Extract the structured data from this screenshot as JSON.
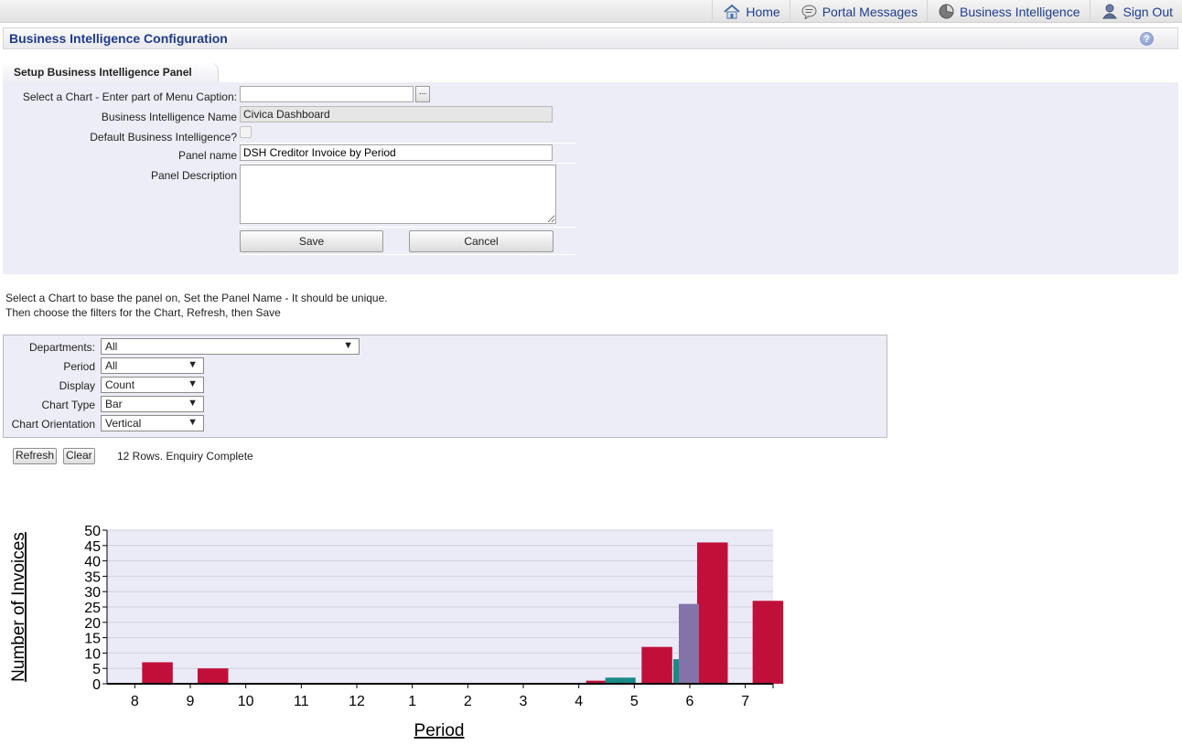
{
  "nav": {
    "home": "Home",
    "portal_messages": "Portal Messages",
    "business_intelligence": "Business Intelligence",
    "sign_out": "Sign Out"
  },
  "title": "Business Intelligence Configuration",
  "tab_label": "Setup Business Intelligence Panel",
  "form": {
    "select_chart_label": "Select a Chart - Enter part of Menu Caption:",
    "select_chart_value": "",
    "ellipsis_label": "...",
    "bi_name_label": "Business Intelligence Name",
    "bi_name_value": "Civica Dashboard",
    "default_bi_label": "Default Business Intelligence?",
    "default_bi_checked": false,
    "panel_name_label": "Panel name",
    "panel_name_value": "DSH Creditor Invoice by Period",
    "panel_description_label": "Panel Description",
    "panel_description_value": "",
    "save_label": "Save",
    "cancel_label": "Cancel"
  },
  "instructions": {
    "line1": "Select a Chart to base the panel on, Set the Panel Name - It should be unique.",
    "line2": "Then choose the filters for the Chart, Refresh, then Save"
  },
  "filters": {
    "departments_label": "Departments:",
    "departments_value": "All",
    "period_label": "Period",
    "period_value": "All",
    "display_label": "Display",
    "display_value": "Count",
    "chart_type_label": "Chart Type",
    "chart_type_value": "Bar",
    "orientation_label": "Chart Orientation",
    "orientation_value": "Vertical",
    "arrow_glyph": "▼"
  },
  "actions": {
    "refresh_label": "Refresh",
    "clear_label": "Clear",
    "status_text": "12 Rows. Enquiry Complete"
  },
  "colors": {
    "series_crimson": "#c0103a",
    "series_teal": "#1a8a87",
    "series_purple": "#8473a8",
    "plot_bg": "#ebebf7",
    "link_blue": "#1e3d8f"
  },
  "chart_data": {
    "type": "bar",
    "xlabel": "Period",
    "ylabel": "Number of Invoices",
    "categories": [
      "8",
      "9",
      "10",
      "11",
      "12",
      "1",
      "2",
      "3",
      "4",
      "5",
      "6",
      "7"
    ],
    "ylim": [
      0,
      50
    ],
    "yticks": [
      0,
      5,
      10,
      15,
      20,
      25,
      30,
      35,
      40,
      45,
      50
    ],
    "grid": true,
    "series": [
      {
        "color": "#c0103a",
        "values": [
          7,
          5,
          0,
          0,
          0,
          0,
          0,
          0,
          1,
          12,
          46,
          27
        ]
      },
      {
        "color": "#1a8a87",
        "values": [
          0,
          0,
          0,
          0,
          0,
          0,
          0,
          0,
          2,
          0,
          8,
          0
        ]
      },
      {
        "color": "#8473a8",
        "values": [
          0,
          0,
          0,
          0,
          0,
          0,
          0,
          0,
          0,
          0,
          26,
          0
        ]
      }
    ]
  }
}
